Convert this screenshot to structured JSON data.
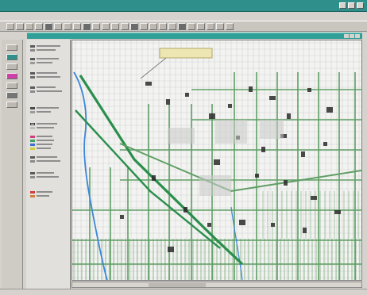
{
  "window": {
    "title": "",
    "menu": []
  },
  "inner_window": {
    "title": ""
  },
  "map": {
    "callout_text": ""
  },
  "colors": {
    "outer_title_bar": "#2f8f8a",
    "inner_title_bar": "#2f9f98",
    "street_network": "#5f9f64",
    "water": "#3b86d8",
    "highway": "#2a8e4b",
    "parcel_lines": "#9aa0a3"
  },
  "icons": {
    "close": "close-icon",
    "maximize": "maximize-icon",
    "minimize": "minimize-icon",
    "pan": "pan-icon",
    "zoom": "zoom-icon",
    "select": "select-icon"
  }
}
